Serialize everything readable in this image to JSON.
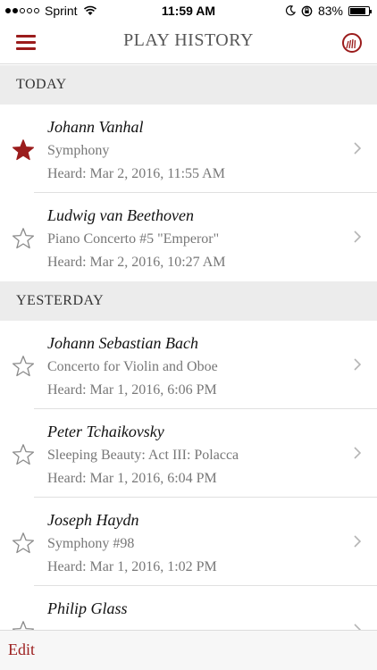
{
  "status_bar": {
    "carrier": "Sprint",
    "time": "11:59 AM",
    "battery": "83%",
    "battery_level": 0.83
  },
  "nav": {
    "title": "PLAY HISTORY"
  },
  "colors": {
    "accent": "#9b1c1c",
    "section_bg": "#ececec",
    "secondary_text": "#777777"
  },
  "sections": [
    {
      "header": "TODAY",
      "items": [
        {
          "composer": "Johann Vanhal",
          "work": "Symphony",
          "heard": "Heard: Mar 2, 2016, 11:55 AM",
          "starred": true
        },
        {
          "composer": "Ludwig van Beethoven",
          "work": "Piano Concerto #5  \"Emperor\"",
          "heard": "Heard: Mar 2, 2016, 10:27 AM",
          "starred": false
        }
      ]
    },
    {
      "header": "YESTERDAY",
      "items": [
        {
          "composer": "Johann Sebastian Bach",
          "work": "Concerto for Violin and Oboe",
          "heard": "Heard: Mar 1, 2016, 6:06 PM",
          "starred": false
        },
        {
          "composer": "Peter Tchaikovsky",
          "work": "Sleeping Beauty: Act III: Polacca",
          "heard": "Heard: Mar 1, 2016, 6:04 PM",
          "starred": false
        },
        {
          "composer": "Joseph Haydn",
          "work": "Symphony #98",
          "heard": "Heard: Mar 1, 2016, 1:02 PM",
          "starred": false
        },
        {
          "composer": "Philip Glass",
          "work": "",
          "heard": "",
          "starred": false
        }
      ]
    }
  ],
  "bottom_bar": {
    "edit_label": "Edit"
  }
}
